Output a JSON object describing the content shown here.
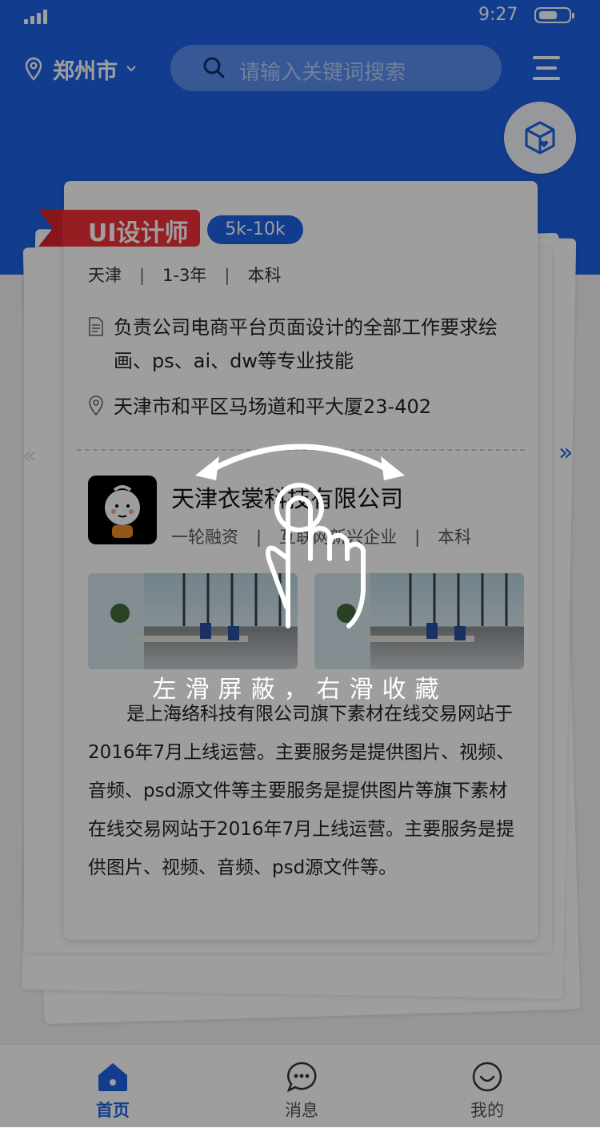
{
  "status_bar": {
    "time": "9:27"
  },
  "header": {
    "city": "郑州市",
    "search_placeholder": "请输入关键词搜索"
  },
  "job": {
    "title": "UI设计师",
    "salary": "5k-10k",
    "meta": [
      "天津",
      "1-3年",
      "本科"
    ],
    "description": "负责公司电商平台页面设计的全部工作要求绘画、ps、ai、dw等专业技能",
    "address": "天津市和平区马场道和平大厦23-402"
  },
  "company": {
    "name": "天津衣裳科技有限公司",
    "tags": [
      "一轮融资",
      "互联网新兴企业",
      "本科"
    ],
    "intro": "是上海络科技有限公司旗下素材在线交易网站于2016年7月上线运营。主要服务是提供图片、视频、音频、psd源文件等主要服务是提供图片等旗下素材在线交易网站于2016年7月上线运营。主要服务是提供图片、视频、音频、psd源文件等。"
  },
  "overlay": {
    "hint": "左滑屏蔽，右滑收藏"
  },
  "tabbar": {
    "items": [
      {
        "label": "首页",
        "icon": "home-icon",
        "active": true
      },
      {
        "label": "消息",
        "icon": "chat-bubble-icon",
        "active": false
      },
      {
        "label": "我的",
        "icon": "smile-icon",
        "active": false
      }
    ]
  },
  "colors": {
    "primary": "#1d63e6",
    "ribbon_red": "#f23036",
    "overlay": "rgba(0,0,0,0.38)"
  }
}
